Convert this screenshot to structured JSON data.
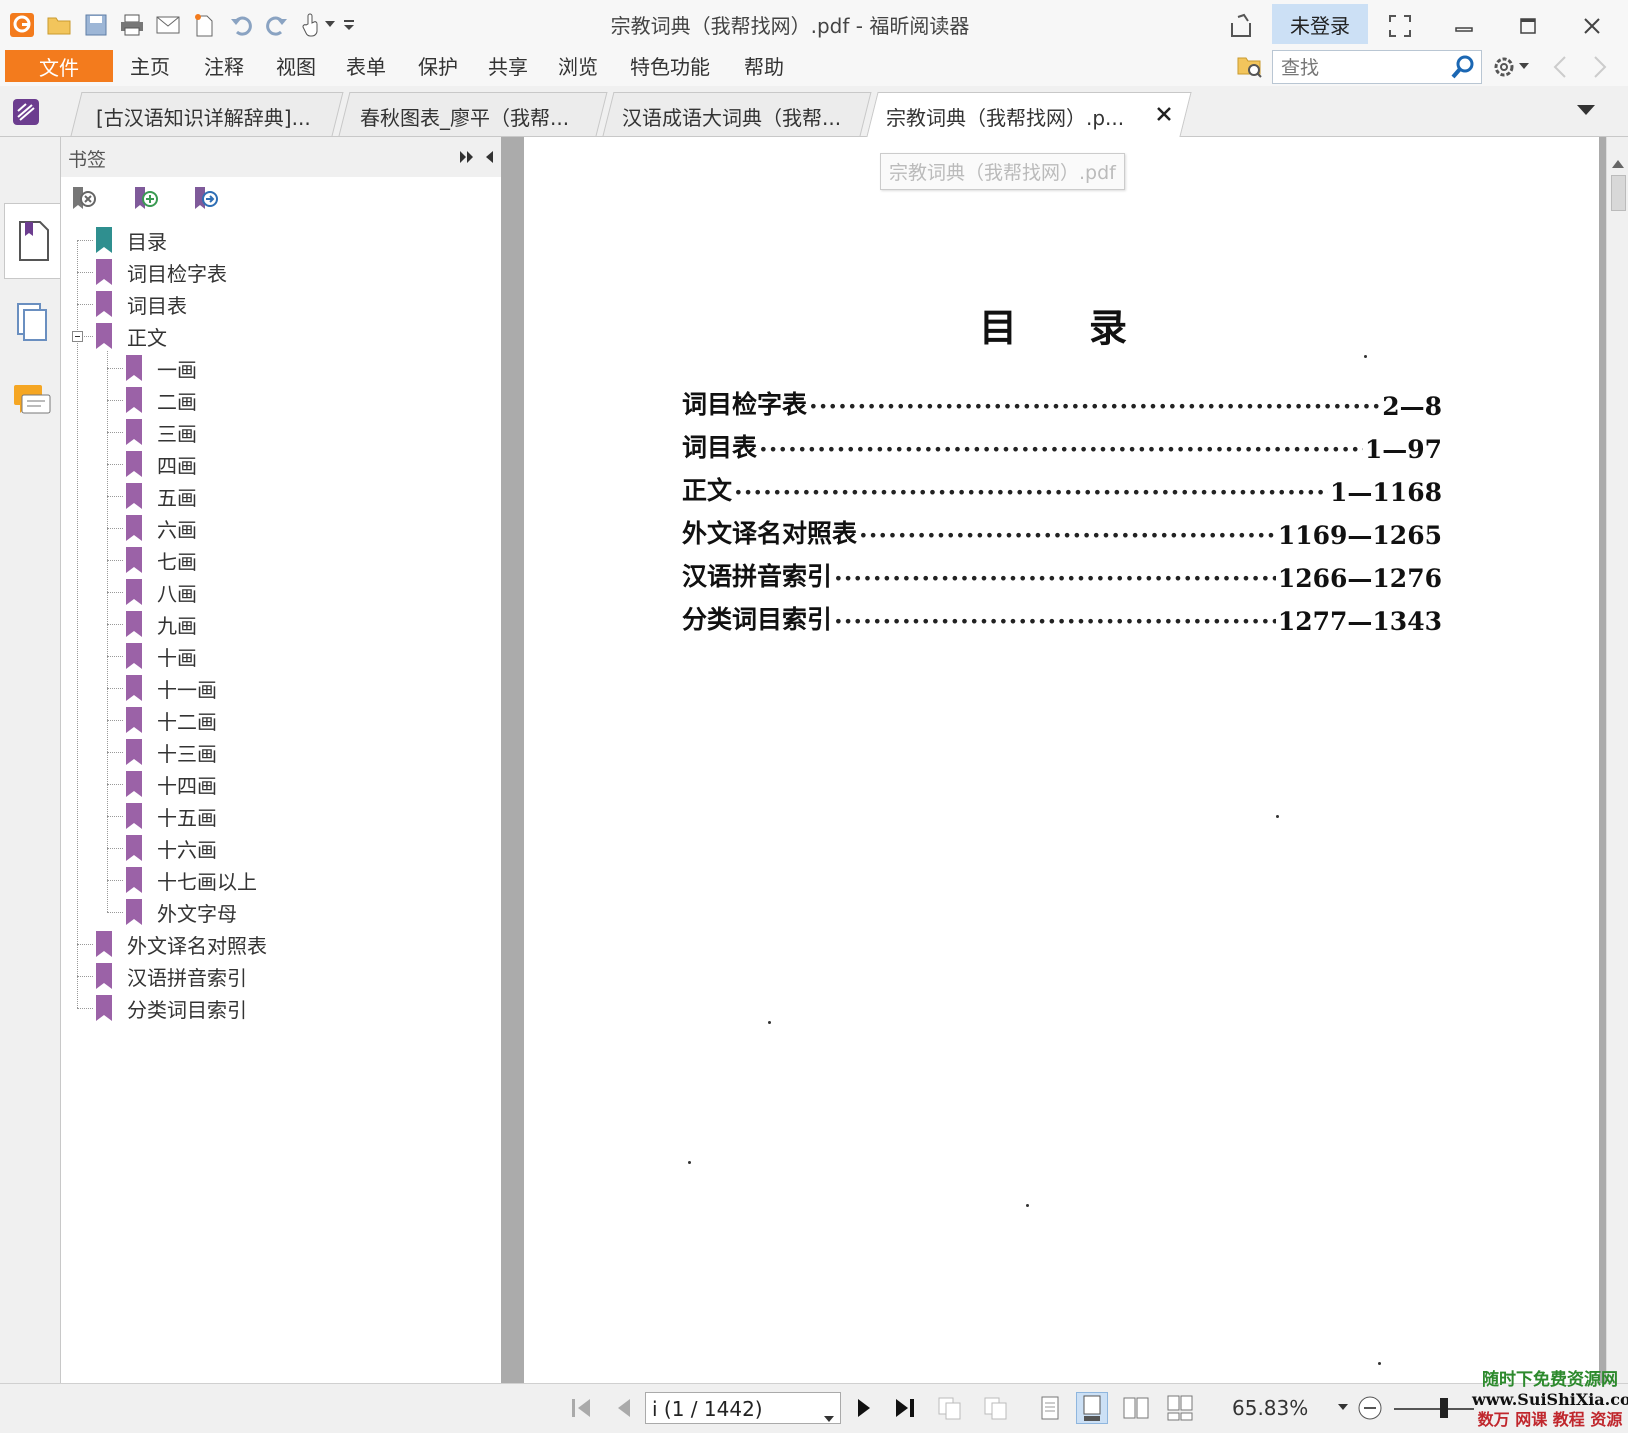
{
  "window": {
    "title": "宗教词典（我帮找网）.pdf - 福昕阅读器",
    "login_label": "未登录"
  },
  "menu": {
    "file": "文件",
    "items": [
      "主页",
      "注释",
      "视图",
      "表单",
      "保护",
      "共享",
      "浏览",
      "特色功能",
      "帮助"
    ]
  },
  "search": {
    "placeholder": "查找"
  },
  "tabs": [
    {
      "label": "[古汉语知识详解辞典]..."
    },
    {
      "label": "春秋图表_廖平（我帮..."
    },
    {
      "label": "汉语成语大词典（我帮..."
    },
    {
      "label": "宗教词典（我帮找网）.p..."
    }
  ],
  "bookmarks": {
    "title": "书签",
    "items": [
      {
        "label": "目录",
        "level": 0,
        "color": "teal"
      },
      {
        "label": "词目检字表",
        "level": 0
      },
      {
        "label": "词目表",
        "level": 0
      },
      {
        "label": "正文",
        "level": 0,
        "expanded": true
      },
      {
        "label": "一画",
        "level": 1
      },
      {
        "label": "二画",
        "level": 1
      },
      {
        "label": "三画",
        "level": 1
      },
      {
        "label": "四画",
        "level": 1
      },
      {
        "label": "五画",
        "level": 1
      },
      {
        "label": "六画",
        "level": 1
      },
      {
        "label": "七画",
        "level": 1
      },
      {
        "label": "八画",
        "level": 1
      },
      {
        "label": "九画",
        "level": 1
      },
      {
        "label": "十画",
        "level": 1
      },
      {
        "label": "十一画",
        "level": 1
      },
      {
        "label": "十二画",
        "level": 1
      },
      {
        "label": "十三画",
        "level": 1
      },
      {
        "label": "十四画",
        "level": 1
      },
      {
        "label": "十五画",
        "level": 1
      },
      {
        "label": "十六画",
        "level": 1
      },
      {
        "label": "十七画以上",
        "level": 1
      },
      {
        "label": "外文字母",
        "level": 1
      },
      {
        "label": "外文译名对照表",
        "level": 0
      },
      {
        "label": "汉语拼音索引",
        "level": 0
      },
      {
        "label": "分类词目索引",
        "level": 0
      }
    ]
  },
  "document": {
    "label": "宗教词典（我帮找网）.pdf",
    "toc_title": "目录",
    "toc": [
      {
        "entry": "词目检字表",
        "pages": "2—8"
      },
      {
        "entry": "词目表",
        "pages": "1—97"
      },
      {
        "entry": "正文",
        "pages": "1—1168"
      },
      {
        "entry": "外文译名对照表",
        "pages": "1169—1265"
      },
      {
        "entry": "汉语拼音索引",
        "pages": "1266—1276"
      },
      {
        "entry": "分类词目索引",
        "pages": "1277—1343"
      }
    ]
  },
  "status": {
    "page_value": "i (1 / 1442)",
    "zoom": "65.83%"
  },
  "watermark": {
    "line1": "随时下免费资源网",
    "line2": "www.SuiShiXia.com",
    "line3": "数万 网课 教程 资源"
  },
  "colors": {
    "accent": "#f37b1d",
    "bookmark_purple": "#9b62a7",
    "bookmark_teal": "#2f8f8f",
    "selected_blue": "#cce0f5"
  }
}
